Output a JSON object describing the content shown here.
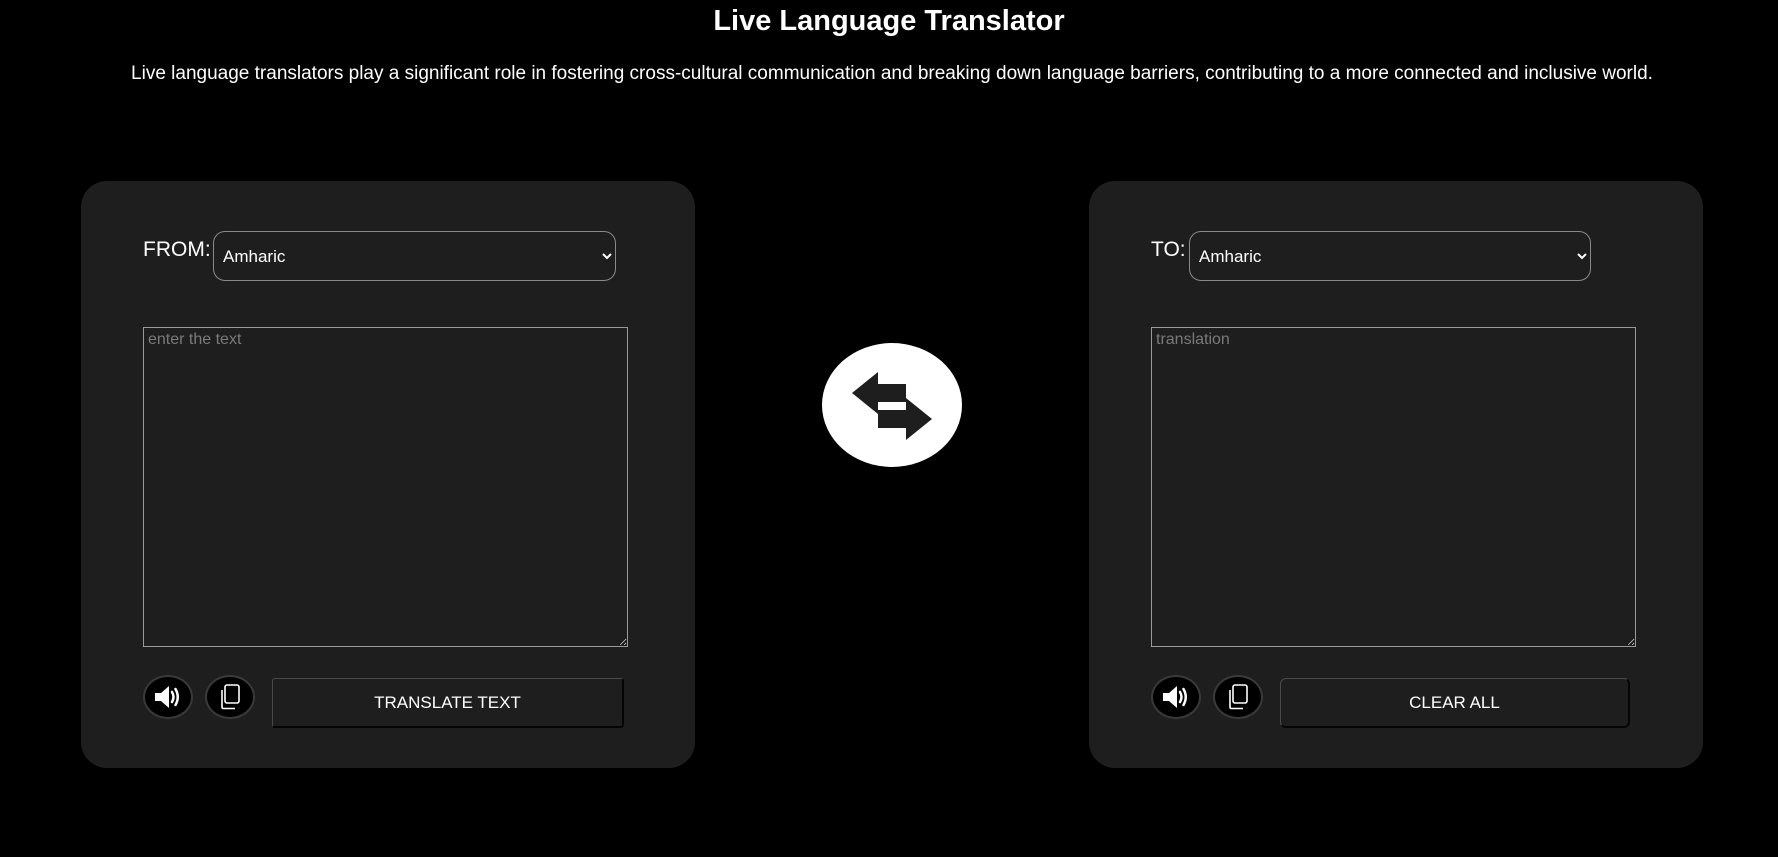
{
  "header": {
    "title": "Live Language Translator",
    "description": "Live language translators play a significant role in fostering cross-cultural communication and breaking down language barriers, contributing to a more connected and inclusive world."
  },
  "source_panel": {
    "label": "FROM:",
    "selected_language": "Amharic",
    "placeholder": "enter the text",
    "value": "",
    "action_label": "TRANSLATE TEXT",
    "speak_icon": "speaker-icon",
    "copy_icon": "copy-icon"
  },
  "target_panel": {
    "label": "TO:",
    "selected_language": "Amharic",
    "placeholder": "translation",
    "value": "",
    "action_label": "CLEAR ALL",
    "speak_icon": "speaker-icon",
    "copy_icon": "copy-icon"
  },
  "swap": {
    "icon": "swap-arrows-icon"
  },
  "colors": {
    "background": "#000000",
    "panel": "#1e1e1e",
    "text": "#ffffff",
    "placeholder": "#7a7a7a",
    "swap_button": "#ffffff",
    "swap_icon": "#1e1e1e"
  }
}
